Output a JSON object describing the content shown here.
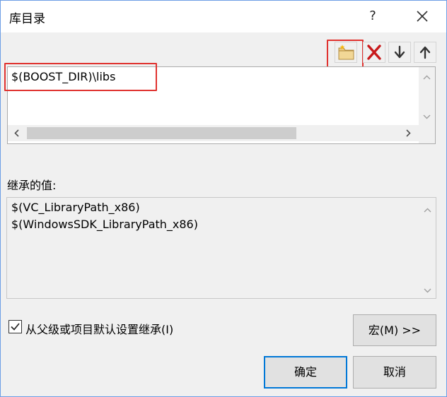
{
  "dialog": {
    "title": "库目录",
    "help_label": "?",
    "close_icon": "close-icon"
  },
  "toolbar": {
    "new_folder_icon": "new-folder-icon",
    "delete_icon": "delete-icon",
    "move_down_icon": "move-down-icon",
    "move_up_icon": "move-up-icon"
  },
  "directories": {
    "items": [
      "$(BOOST_DIR)\\libs"
    ]
  },
  "inherited": {
    "label": "继承的值:",
    "values": [
      "$(VC_LibraryPath_x86)",
      "$(WindowsSDK_LibraryPath_x86)"
    ]
  },
  "inherit_checkbox": {
    "label": "从父级或项目默认设置继承(I)",
    "checked": true
  },
  "buttons": {
    "macros": "宏(M) >>",
    "ok": "确定",
    "cancel": "取消"
  },
  "colors": {
    "highlight": "#e0322f",
    "primary_border": "#0078d7",
    "delete_red": "#c8191b"
  }
}
